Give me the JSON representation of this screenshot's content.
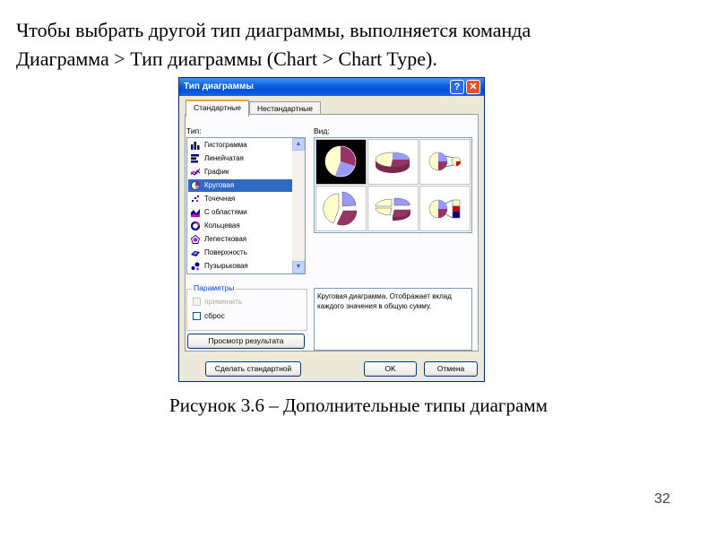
{
  "slide": {
    "line1": "Чтобы выбрать другой тип диаграммы, выполняется команда",
    "line2": "Диаграмма > Тип диаграммы (Chart > Chart Type).",
    "caption": "Рисунок 3.6 – Дополнительные типы диаграмм",
    "page_number": "32"
  },
  "dialog": {
    "title": "Тип диаграммы",
    "help_glyph": "?",
    "close_glyph": "✕",
    "tabs": [
      {
        "label": "Стандартные",
        "active": true
      },
      {
        "label": "Нестандартные",
        "active": false
      }
    ],
    "type_label": "Тип:",
    "view_label": "Вид:",
    "chart_types": [
      {
        "label": "Гистограмма",
        "icon": "column-chart-icon"
      },
      {
        "label": "Линейчатая",
        "icon": "bar-chart-icon"
      },
      {
        "label": "График",
        "icon": "line-chart-icon"
      },
      {
        "label": "Круговая",
        "icon": "pie-chart-icon",
        "selected": true
      },
      {
        "label": "Точечная",
        "icon": "scatter-chart-icon"
      },
      {
        "label": "С областями",
        "icon": "area-chart-icon"
      },
      {
        "label": "Кольцевая",
        "icon": "doughnut-chart-icon"
      },
      {
        "label": "Лепестковая",
        "icon": "radar-chart-icon"
      },
      {
        "label": "Поверхность",
        "icon": "surface-chart-icon"
      },
      {
        "label": "Пузырьковая",
        "icon": "bubble-chart-icon"
      }
    ],
    "scroll_up": "▲",
    "scroll_down": "▼",
    "options_group": {
      "title": "Параметры",
      "apply": "применить",
      "reset": "сброс"
    },
    "description": "Круговая диаграмма. Отображает вклад каждого значения в общую сумму.",
    "preview_button": "Просмотр результата",
    "make_default_button": "Сделать стандартной",
    "ok_button": "OK",
    "cancel_button": "Отмена",
    "colors": {
      "pie_periwinkle": "#9999ff",
      "pie_maroon": "#993366",
      "pie_cream": "#ffffcc",
      "selection_blue": "#316ac5",
      "title_blue": "#0a5ddb"
    }
  }
}
